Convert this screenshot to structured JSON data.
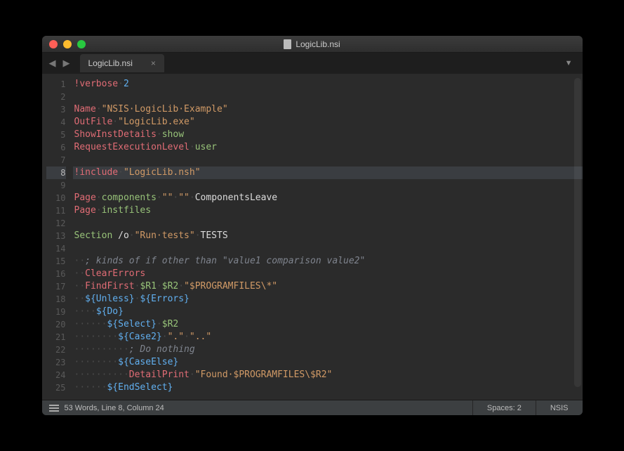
{
  "window": {
    "title": "LogicLib.nsi"
  },
  "tabs": [
    {
      "label": "LogicLib.nsi"
    }
  ],
  "status": {
    "left": "53 Words, Line 8, Column 24",
    "spaces": "Spaces: 2",
    "syntax": "NSIS"
  },
  "code": {
    "lines": [
      {
        "n": 1,
        "tokens": [
          [
            "k-red",
            "!verbose"
          ],
          [
            "ws",
            "·"
          ],
          [
            "k-blue",
            "2"
          ]
        ]
      },
      {
        "n": 2,
        "tokens": []
      },
      {
        "n": 3,
        "tokens": [
          [
            "k-red",
            "Name"
          ],
          [
            "ws",
            "·"
          ],
          [
            "k-orange",
            "\"NSIS·LogicLib·Example\""
          ]
        ]
      },
      {
        "n": 4,
        "tokens": [
          [
            "k-red",
            "OutFile"
          ],
          [
            "ws",
            "·"
          ],
          [
            "k-orange",
            "\"LogicLib.exe\""
          ]
        ]
      },
      {
        "n": 5,
        "tokens": [
          [
            "k-red",
            "ShowInstDetails"
          ],
          [
            "ws",
            "·"
          ],
          [
            "k-green",
            "show"
          ]
        ]
      },
      {
        "n": 6,
        "tokens": [
          [
            "k-red",
            "RequestExecutionLevel"
          ],
          [
            "ws",
            "·"
          ],
          [
            "k-green",
            "user"
          ]
        ]
      },
      {
        "n": 7,
        "tokens": []
      },
      {
        "n": 8,
        "hl": true,
        "tokens": [
          [
            "k-red",
            "!include"
          ],
          [
            "ws",
            "·"
          ],
          [
            "k-orange",
            "\"LogicLib.nsh\""
          ]
        ]
      },
      {
        "n": 9,
        "tokens": []
      },
      {
        "n": 10,
        "tokens": [
          [
            "k-red",
            "Page"
          ],
          [
            "ws",
            "·"
          ],
          [
            "k-green",
            "components"
          ],
          [
            "ws",
            "·"
          ],
          [
            "k-orange",
            "\"\""
          ],
          [
            "ws",
            "·"
          ],
          [
            "k-orange",
            "\"\""
          ],
          [
            "ws",
            "·"
          ],
          [
            "k-white",
            "ComponentsLeave"
          ]
        ]
      },
      {
        "n": 11,
        "tokens": [
          [
            "k-red",
            "Page"
          ],
          [
            "ws",
            "·"
          ],
          [
            "k-green",
            "instfiles"
          ]
        ]
      },
      {
        "n": 12,
        "tokens": []
      },
      {
        "n": 13,
        "tokens": [
          [
            "k-green",
            "Section"
          ],
          [
            "k-white",
            " /o"
          ],
          [
            "ws",
            "·"
          ],
          [
            "k-orange",
            "\"Run·tests\""
          ],
          [
            "ws",
            "·"
          ],
          [
            "k-white",
            "TESTS"
          ]
        ]
      },
      {
        "n": 14,
        "tokens": []
      },
      {
        "n": 15,
        "tokens": [
          [
            "ws",
            "··"
          ],
          [
            "k-grey",
            "; kinds of if other than \"value1 comparison value2\""
          ]
        ]
      },
      {
        "n": 16,
        "tokens": [
          [
            "ws",
            "··"
          ],
          [
            "k-red",
            "ClearErrors"
          ]
        ]
      },
      {
        "n": 17,
        "tokens": [
          [
            "ws",
            "··"
          ],
          [
            "k-red",
            "FindFirst"
          ],
          [
            "ws",
            "·"
          ],
          [
            "k-green",
            "$R1"
          ],
          [
            "ws",
            "·"
          ],
          [
            "k-green",
            "$R2"
          ],
          [
            "ws",
            "·"
          ],
          [
            "k-orange",
            "\"$PROGRAMFILES\\*\""
          ]
        ]
      },
      {
        "n": 18,
        "tokens": [
          [
            "ws",
            "··"
          ],
          [
            "k-blue",
            "${Unless}"
          ],
          [
            "ws",
            "·"
          ],
          [
            "k-blue",
            "${Errors}"
          ]
        ]
      },
      {
        "n": 19,
        "tokens": [
          [
            "ws",
            "····"
          ],
          [
            "k-blue",
            "${Do}"
          ]
        ]
      },
      {
        "n": 20,
        "tokens": [
          [
            "ws",
            "······"
          ],
          [
            "k-blue",
            "${Select}"
          ],
          [
            "ws",
            "·"
          ],
          [
            "k-green",
            "$R2"
          ]
        ]
      },
      {
        "n": 21,
        "tokens": [
          [
            "ws",
            "········"
          ],
          [
            "k-blue",
            "${Case2}"
          ],
          [
            "ws",
            "·"
          ],
          [
            "k-orange",
            "\".\""
          ],
          [
            "ws",
            "·"
          ],
          [
            "k-orange",
            "\"..\""
          ]
        ]
      },
      {
        "n": 22,
        "tokens": [
          [
            "ws",
            "··········"
          ],
          [
            "k-grey",
            "; Do nothing"
          ]
        ]
      },
      {
        "n": 23,
        "tokens": [
          [
            "ws",
            "········"
          ],
          [
            "k-blue",
            "${CaseElse}"
          ]
        ]
      },
      {
        "n": 24,
        "tokens": [
          [
            "ws",
            "··········"
          ],
          [
            "k-red",
            "DetailPrint"
          ],
          [
            "ws",
            "·"
          ],
          [
            "k-orange",
            "\"Found·$PROGRAMFILES\\$R2\""
          ]
        ]
      },
      {
        "n": 25,
        "tokens": [
          [
            "ws",
            "······"
          ],
          [
            "k-blue",
            "${EndSelect}"
          ]
        ]
      }
    ]
  }
}
